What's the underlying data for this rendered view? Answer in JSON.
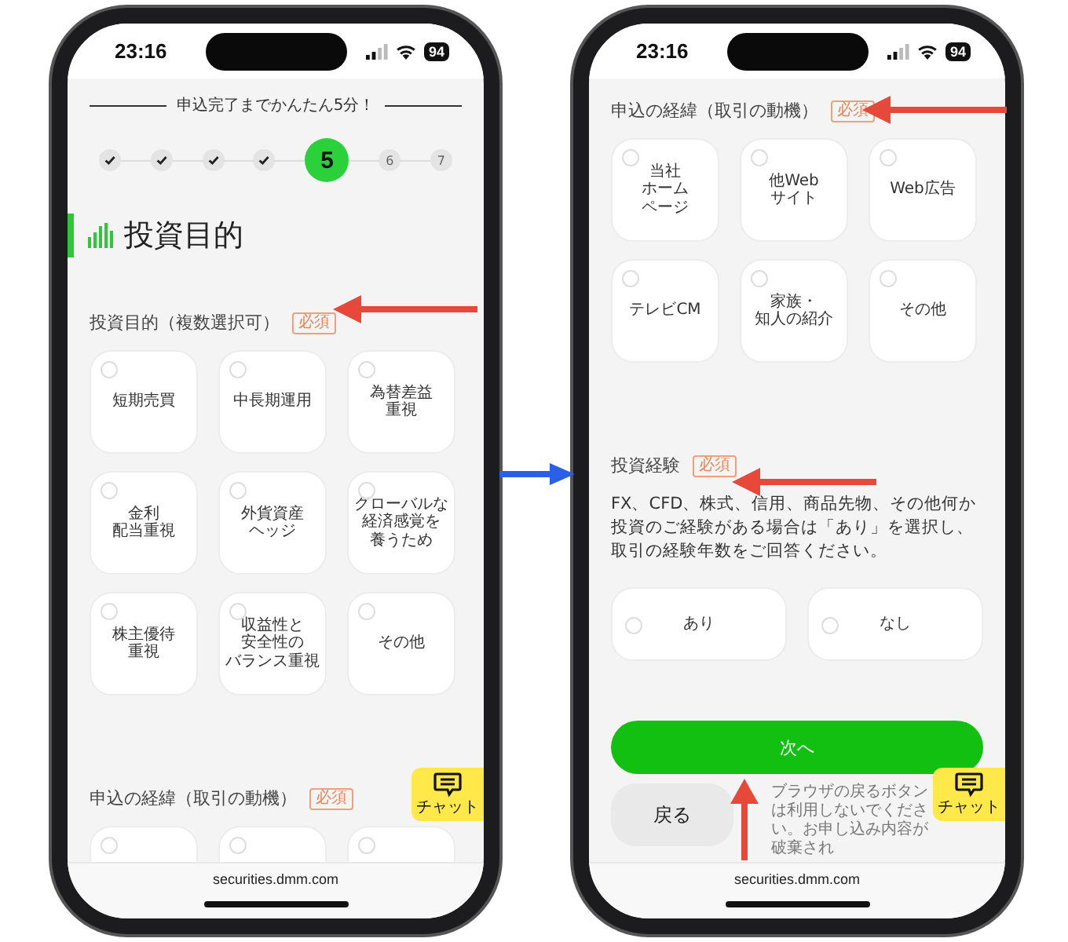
{
  "phones": [
    {
      "status_bar": {
        "time": "23:16",
        "battery": "94"
      },
      "progress": {
        "caption": "申込完了までかんたん5分！",
        "steps": [
          {
            "done": true,
            "current": false
          },
          {
            "done": true,
            "current": false
          },
          {
            "done": true,
            "current": false
          },
          {
            "done": true,
            "current": false
          },
          {
            "label": "5",
            "done": false,
            "current": true
          },
          {
            "label": "6",
            "done": false,
            "current": false
          },
          {
            "label": "7",
            "done": false,
            "current": false
          }
        ]
      },
      "heading": "投資目的",
      "sections": [
        {
          "label": "投資目的（複数選択可）",
          "badge": "必須",
          "kind": "tiles",
          "options": [
            {
              "lines": [
                "短期売買"
              ],
              "selected": false
            },
            {
              "lines": [
                "中長期運用"
              ],
              "selected": false
            },
            {
              "lines": [
                "為替差益",
                "重視"
              ],
              "selected": false
            },
            {
              "lines": [
                "金利",
                "配当重視"
              ],
              "selected": false
            },
            {
              "lines": [
                "外貨資産",
                "ヘッジ"
              ],
              "selected": false
            },
            {
              "lines": [
                "グローバルな",
                "経済感覚を",
                "養うため"
              ],
              "selected": false
            },
            {
              "lines": [
                "株主優待",
                "重視"
              ],
              "selected": false
            },
            {
              "lines": [
                "収益性と",
                "安全性の",
                "バランス重視"
              ],
              "selected": false
            },
            {
              "lines": [
                "その他"
              ],
              "selected": false
            }
          ]
        },
        {
          "label": "申込の経緯（取引の動機）",
          "badge": "必須",
          "kind": "tiles",
          "options": [
            {
              "selected": false
            },
            {
              "selected": false
            },
            {
              "selected": false
            }
          ]
        }
      ],
      "chat": "チャット",
      "url": "securities.dmm.com"
    },
    {
      "status_bar": {
        "time": "23:16",
        "battery": "94"
      },
      "sections": [
        {
          "label": "申込の経緯（取引の動機）",
          "badge": "必須",
          "kind": "tiles",
          "options": [
            {
              "lines": [
                "当社",
                "ホーム",
                "ページ"
              ],
              "selected": false
            },
            {
              "lines": [
                "他Web",
                "サイト"
              ],
              "selected": false
            },
            {
              "lines": [
                "Web広告"
              ],
              "selected": false
            },
            {
              "lines": [
                "テレビCM"
              ],
              "selected": false
            },
            {
              "lines": [
                "家族・",
                "知人の紹介"
              ],
              "selected": false
            },
            {
              "lines": [
                "その他"
              ],
              "selected": false
            }
          ]
        },
        {
          "label": "投資経験",
          "badge": "必須",
          "kind": "pair",
          "description": "FX、CFD、株式、信用、商品先物、その他何か投資のご経験がある場合は「あり」を選択し、取引の経験年数をご回答ください。",
          "options": [
            {
              "lines": [
                "あり"
              ],
              "selected": false
            },
            {
              "lines": [
                "なし"
              ],
              "selected": false
            }
          ]
        }
      ],
      "actions": {
        "next": "次へ",
        "back": "戻る",
        "note": "ブラウザの戻るボタンは利用しないでください。お申し込み内容が破棄され"
      },
      "chat": "チャット",
      "url": "securities.dmm.com"
    }
  ]
}
